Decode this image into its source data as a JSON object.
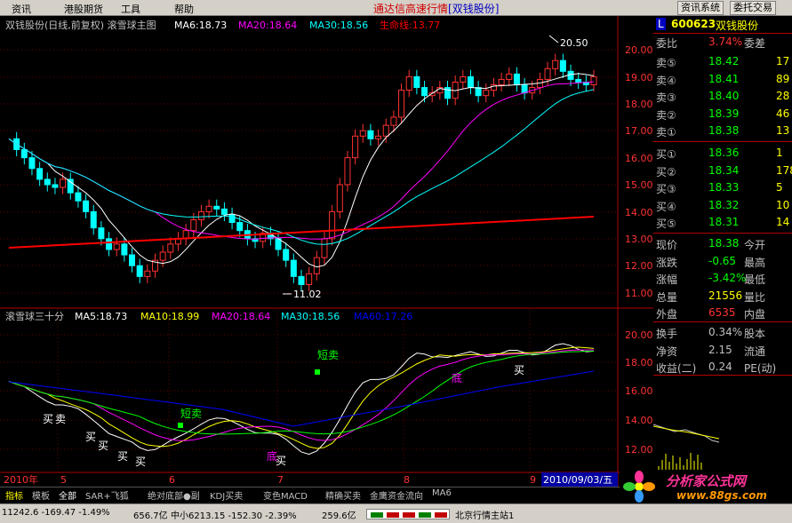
{
  "menubar": {
    "items": [
      "资讯",
      "港股期货",
      "工具",
      "帮助"
    ],
    "title": "通达信高速行情",
    "stock_tag": "[双钱股份]",
    "buttons": [
      "资讯系统",
      "委托交易"
    ]
  },
  "main_chart": {
    "header": "双钱股份(日线,前复权) 滚雪球主图",
    "ma6": "MA6:18.73",
    "ma20": "MA20:18.64",
    "ma30": "MA30:18.56",
    "lifeline": "生命线:13.77",
    "high_label": "20.50",
    "low_label": "11.02",
    "y_ticks": [
      "20.00",
      "19.00",
      "18.00",
      "17.00",
      "16.00",
      "15.00",
      "14.00",
      "13.00",
      "12.00",
      "11.00"
    ]
  },
  "sub_chart": {
    "header": "滚雪球三十分",
    "ma5": "MA5:18.73",
    "ma10": "MA10:18.99",
    "ma20": "MA20:18.64",
    "ma30": "MA30:18.56",
    "ma60": "MA60:17.26",
    "y_ticks": [
      "20.00",
      "18.00",
      "16.00",
      "14.00",
      "12.00"
    ],
    "annotations": {
      "short_sell": "短卖",
      "short_sell2": "短卖",
      "sell": "卖",
      "buy": "买",
      "bottom": "底"
    }
  },
  "xaxis": {
    "labels": [
      "2010年",
      "5",
      "6",
      "7",
      "8",
      "9"
    ],
    "date": "2010/09/03/五"
  },
  "quote": {
    "code": "600623",
    "name": "双钱股份",
    "l_badge": "L",
    "wb_label": "委比",
    "wb_value": "3.74%",
    "wc_label": "委差",
    "sells": [
      {
        "label": "卖⑤",
        "price": "18.42",
        "vol": "17"
      },
      {
        "label": "卖④",
        "price": "18.41",
        "vol": "89"
      },
      {
        "label": "卖③",
        "price": "18.40",
        "vol": "28"
      },
      {
        "label": "卖②",
        "price": "18.39",
        "vol": "46"
      },
      {
        "label": "卖①",
        "price": "18.38",
        "vol": "13"
      }
    ],
    "buys": [
      {
        "label": "买①",
        "price": "18.36",
        "vol": "1"
      },
      {
        "label": "买②",
        "price": "18.34",
        "vol": "178"
      },
      {
        "label": "买③",
        "price": "18.33",
        "vol": "5"
      },
      {
        "label": "买④",
        "price": "18.32",
        "vol": "10"
      },
      {
        "label": "买⑤",
        "price": "18.31",
        "vol": "14"
      }
    ],
    "stats": [
      {
        "l": "现价",
        "v": "18.38",
        "r": "今开"
      },
      {
        "l": "涨跌",
        "v": "-0.65",
        "r": "最高"
      },
      {
        "l": "涨幅",
        "v": "-3.42%",
        "r": "最低"
      },
      {
        "l": "总量",
        "v": "21556",
        "r": "量比"
      },
      {
        "l": "外盘",
        "v": "6535",
        "r": "内盘"
      }
    ],
    "stats2": [
      {
        "l": "换手",
        "v": "0.34%",
        "r": "股本"
      },
      {
        "l": "净资",
        "v": "2.15",
        "r": "流通"
      },
      {
        "l": "收益(二)",
        "v": "0.24",
        "r": "PE(动)"
      }
    ]
  },
  "tabs": [
    "指标",
    "模板",
    "全部",
    "SAR+飞狐",
    "绝对底部●副",
    "KDJ买卖",
    "变色MACD",
    "精确买卖",
    "金鹰资金流向",
    "MA6"
  ],
  "statusbar": {
    "sh": "11242.6 -169.47 -1.49%",
    "sh_amt": "656.7亿",
    "sz": "中小6213.15 -152.30 -2.39%",
    "sz_amt": "259.6亿",
    "site": "北京行情主站1"
  },
  "logo": {
    "text": "分析家公式网",
    "url": "www.88gs.com"
  },
  "colors": {
    "up": "#ff3232",
    "down": "#00ffff",
    "ma5": "#ffffff",
    "ma10": "#ffff00",
    "ma20": "#ff00ff",
    "ma30": "#00ff00",
    "ma60": "#0000ff",
    "life": "#ff0000"
  }
}
